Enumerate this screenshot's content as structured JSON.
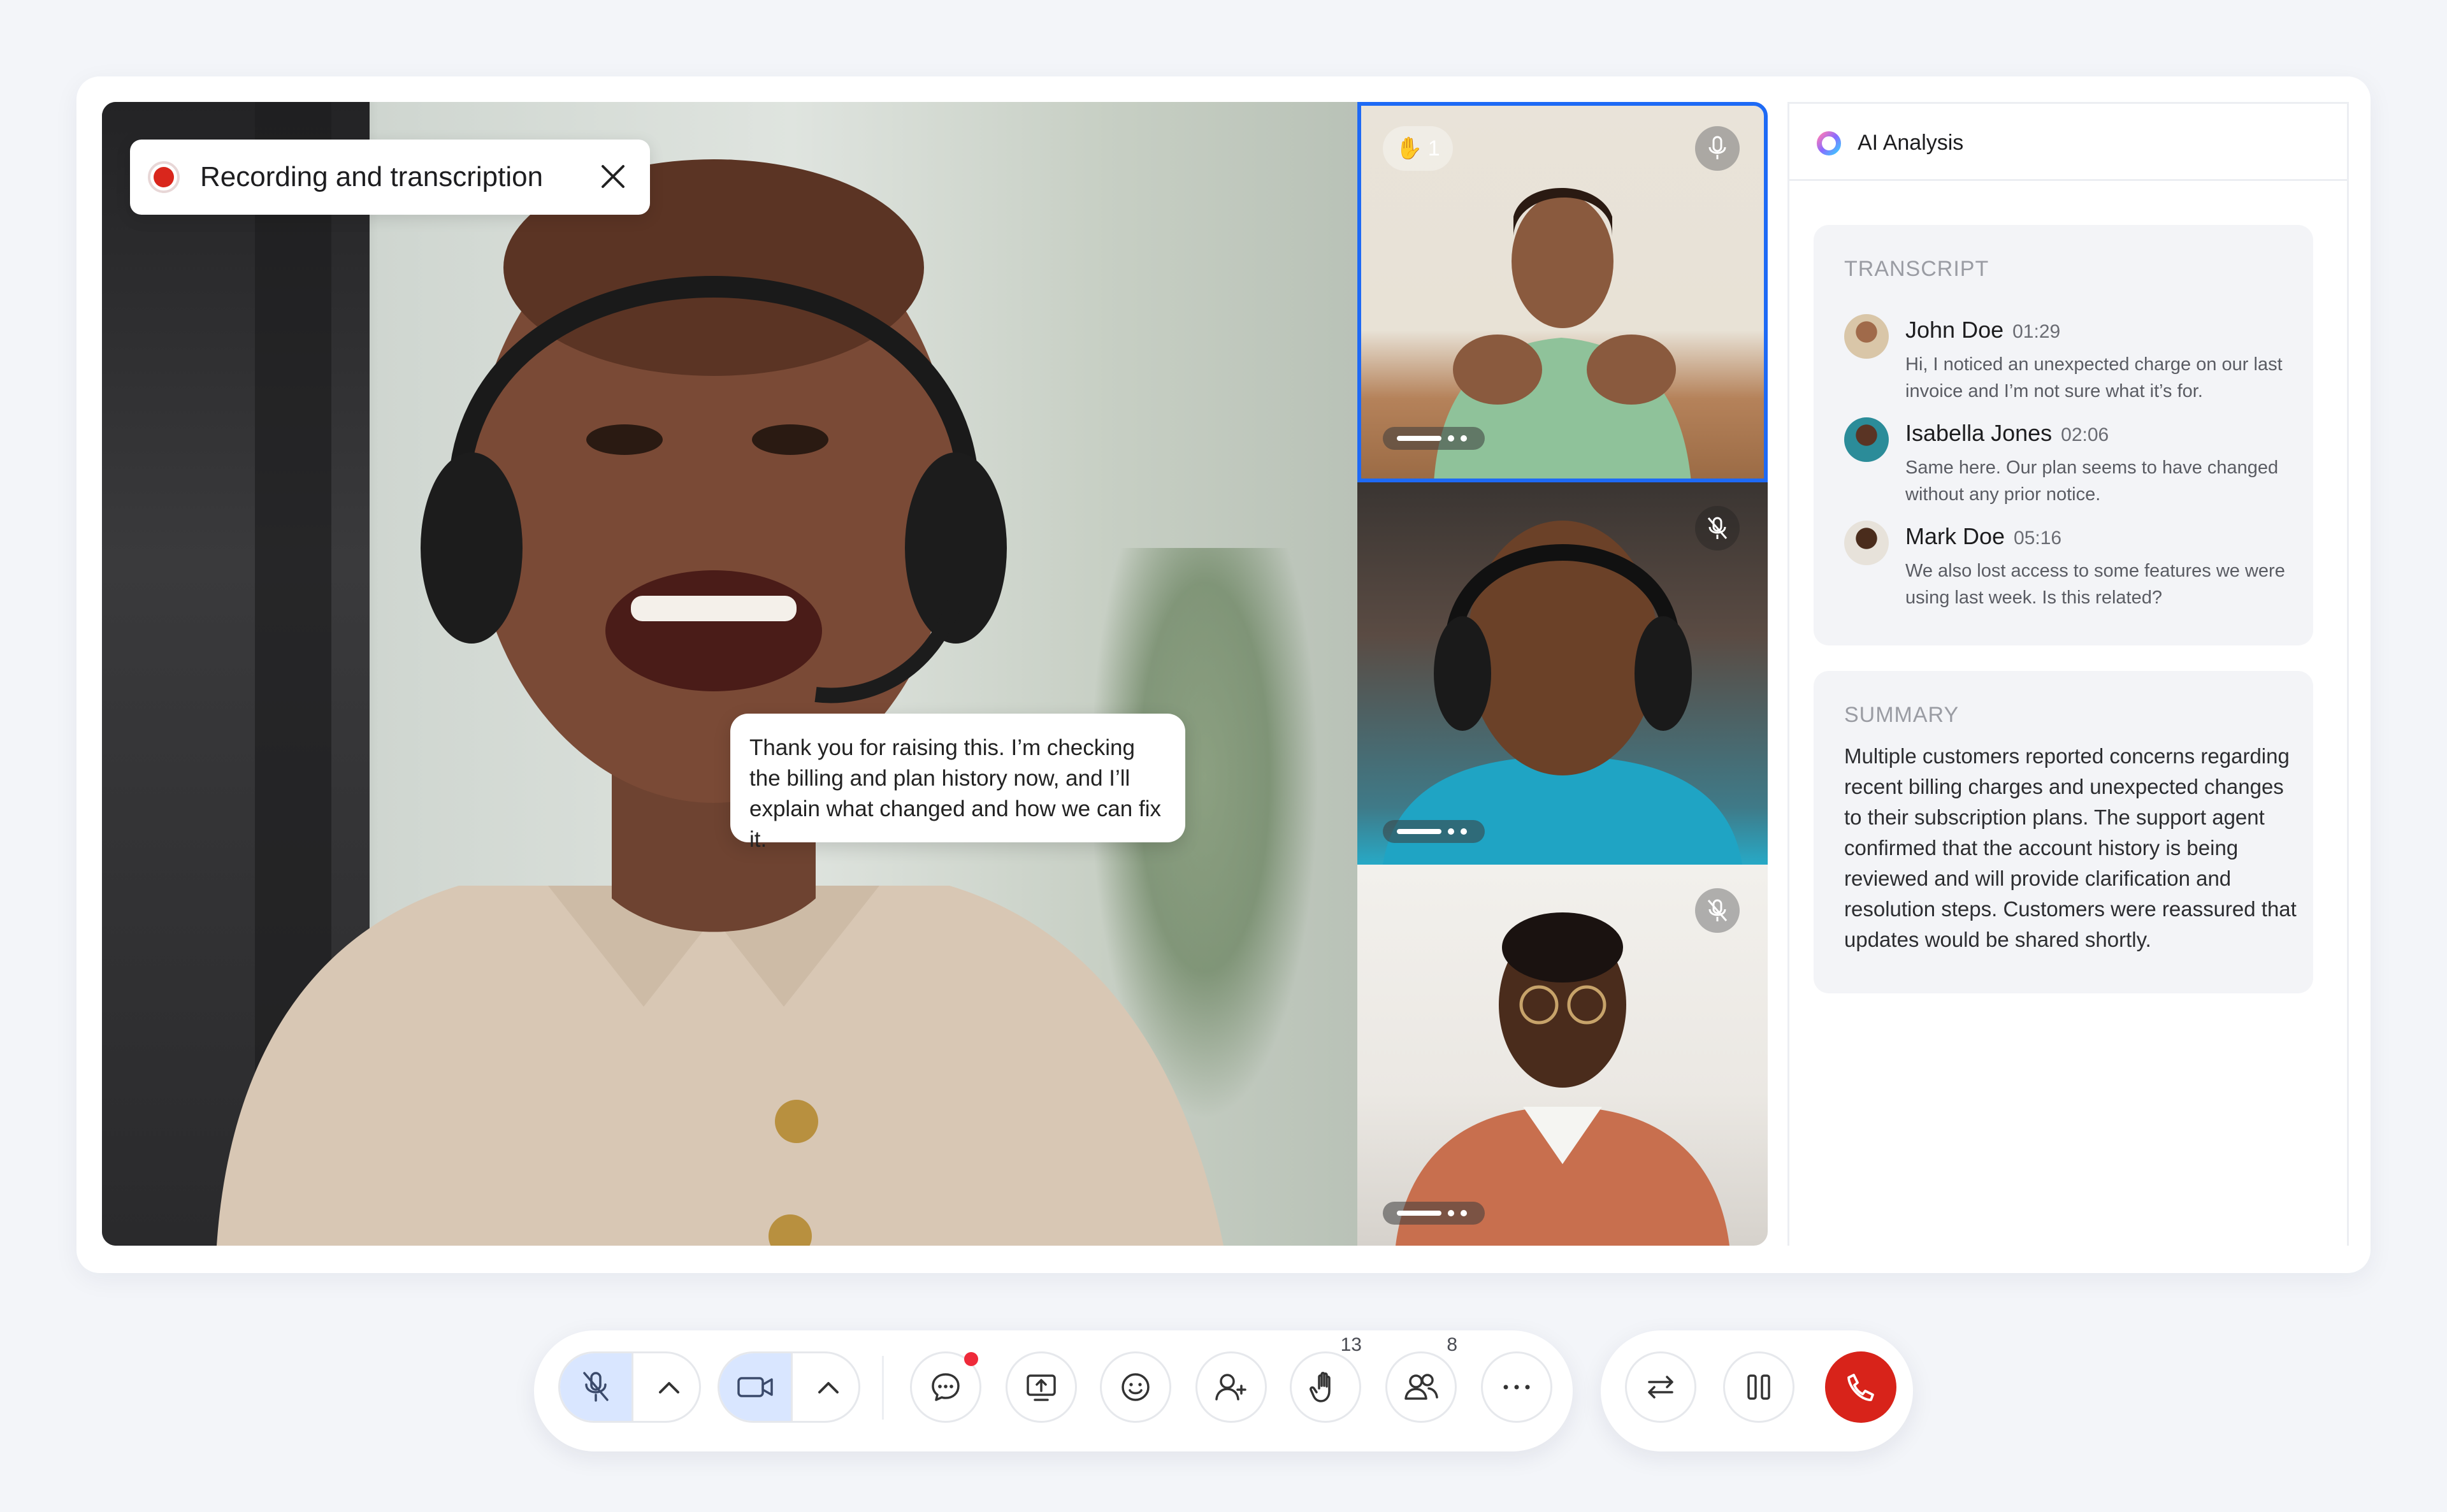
{
  "recording": {
    "label": "Recording and transcription"
  },
  "caption": {
    "text": "Thank you for raising this. I’m checking the billing and plan history now, and I’ll explain what changed and how we can fix it."
  },
  "participants": {
    "raised_hand_count": "1"
  },
  "ai_panel": {
    "title": "AI Analysis",
    "transcript_label": "TRANSCRIPT",
    "transcript": [
      {
        "name": "John Doe",
        "time": "01:29",
        "text": "Hi, I noticed an unexpected charge on our last invoice and I’m not sure what it’s for."
      },
      {
        "name": "Isabella Jones",
        "time": "02:06",
        "text": "Same here. Our plan seems to have changed without any prior notice."
      },
      {
        "name": "Mark Doe",
        "time": "05:16",
        "text": "We also lost access to some features we were using last week. Is this related?"
      }
    ],
    "summary_label": "SUMMARY",
    "summary": "Multiple customers reported concerns regarding recent billing charges and unexpected changes to their subscription plans. The support agent confirmed that the account history is being reviewed and will provide clarification and resolution steps. Customers were reassured that updates would be shared shortly."
  },
  "toolbar": {
    "raised_hands_count": "13",
    "participants_count": "8"
  },
  "colors": {
    "accent": "#1e6af5",
    "end_call": "#d8231a",
    "notification": "#ee2a3a"
  }
}
